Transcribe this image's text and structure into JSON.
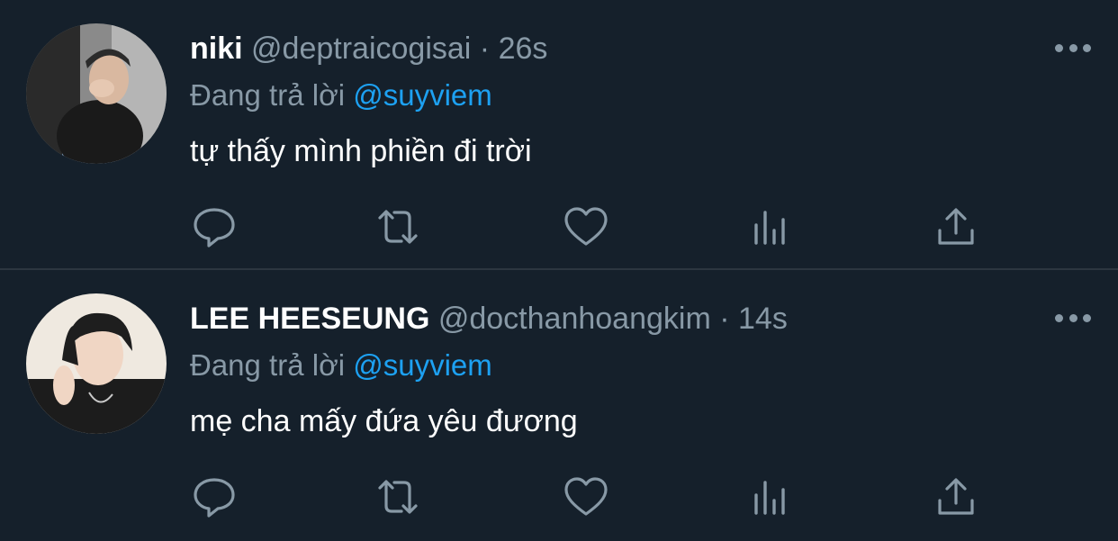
{
  "tweets": [
    {
      "name": "niki",
      "handle": "@deptraicogisai",
      "separator": "·",
      "time": "26s",
      "reply_prefix": "Đang trả lời",
      "reply_to": "@suyviem",
      "text": "tự thấy mình phiền đi trời"
    },
    {
      "name": "LEE HEESEUNG",
      "handle": "@docthanhoangkim",
      "separator": "·",
      "time": "14s",
      "reply_prefix": "Đang trả lời",
      "reply_to": "@suyviem",
      "text": "mẹ cha mấy đứa yêu đương"
    }
  ],
  "colors": {
    "background": "#15202b",
    "muted": "#8899a6",
    "accent": "#1da1f2",
    "divider": "#2c3640"
  },
  "icons": [
    "more-icon",
    "reply-icon",
    "retweet-icon",
    "like-icon",
    "analytics-icon",
    "share-icon"
  ]
}
